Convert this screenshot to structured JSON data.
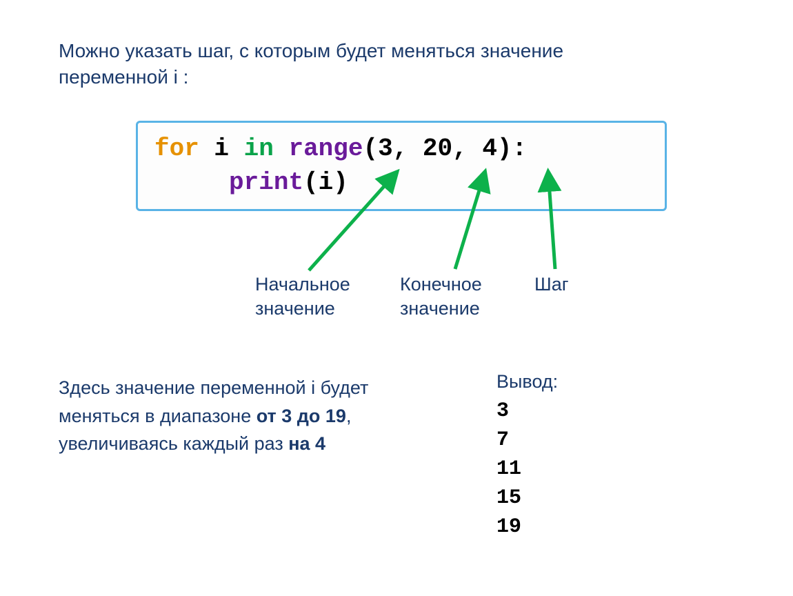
{
  "intro": "Можно указать шаг, с которым будет меняться значение переменной i :",
  "code": {
    "kw_for": "for",
    "var_i": "i",
    "kw_in": "in",
    "fn_range": "range",
    "args": "(3, 20, 4):",
    "fn_print": "print",
    "print_arg": "(i)"
  },
  "labels": {
    "start": "Начальное значение",
    "end": "Конечное значение",
    "step": "Шаг"
  },
  "explain": {
    "p1": "Здесь значение переменной i будет меняться в диапазоне ",
    "b1": "от 3 до 19",
    "p2": ", увеличиваясь каждый раз ",
    "b2": "на 4"
  },
  "output": {
    "header": "Вывод:",
    "values": [
      "3",
      "7",
      "11",
      "15",
      "19"
    ]
  }
}
